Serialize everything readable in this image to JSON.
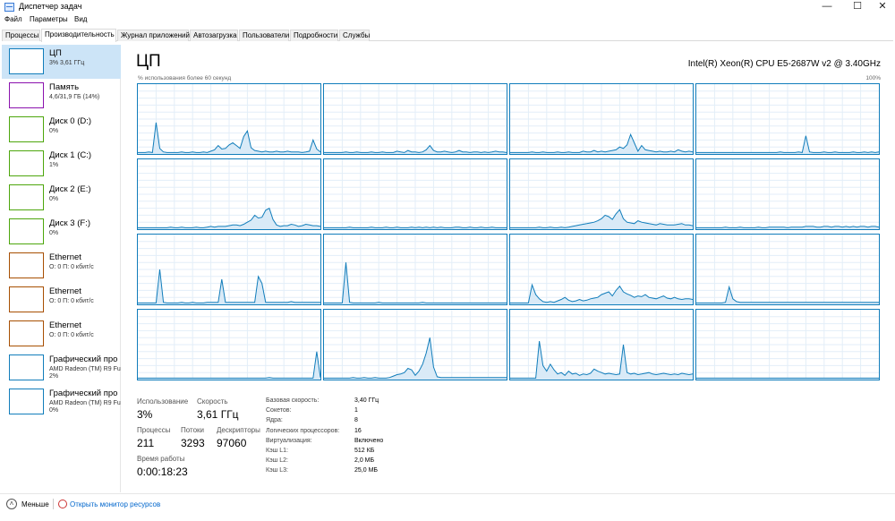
{
  "window": {
    "title": "Диспетчер задач",
    "min_glyph": "—",
    "max_glyph": "☐",
    "close_glyph": "✕"
  },
  "menu": [
    "Файл",
    "Параметры",
    "Вид"
  ],
  "tabs": [
    {
      "label": "Процессы",
      "active": false
    },
    {
      "label": "Производительность",
      "active": true
    },
    {
      "label": "Журнал приложений",
      "active": false
    },
    {
      "label": "Автозагрузка",
      "active": false
    },
    {
      "label": "Пользователи",
      "active": false
    },
    {
      "label": "Подробности",
      "active": false
    },
    {
      "label": "Службы",
      "active": false
    }
  ],
  "sidebar": [
    {
      "label": "ЦП",
      "sub": "3% 3,61 ГГц",
      "sub2": "",
      "color": "#117dbb",
      "icon": "cpu-graph-icon",
      "selected": true
    },
    {
      "label": "Память",
      "sub": "4,6/31,9 ГБ (14%)",
      "sub2": "",
      "color": "#8b12ae",
      "icon": "memory-graph-icon",
      "selected": false
    },
    {
      "label": "Диск 0 (D:)",
      "sub": "0%",
      "sub2": "",
      "color": "#4da60c",
      "icon": "disk-graph-icon",
      "selected": false
    },
    {
      "label": "Диск 1 (C:)",
      "sub": "1%",
      "sub2": "",
      "color": "#4da60c",
      "icon": "disk-graph-icon",
      "selected": false
    },
    {
      "label": "Диск 2 (E:)",
      "sub": "0%",
      "sub2": "",
      "color": "#4da60c",
      "icon": "disk-graph-icon",
      "selected": false
    },
    {
      "label": "Диск 3 (F:)",
      "sub": "0%",
      "sub2": "",
      "color": "#4da60c",
      "icon": "disk-graph-icon",
      "selected": false
    },
    {
      "label": "Ethernet",
      "sub": "О: 0 П: 0 кбит/с",
      "sub2": "",
      "color": "#a74f01",
      "icon": "network-graph-icon",
      "selected": false
    },
    {
      "label": "Ethernet",
      "sub": "О: 0 П: 0 кбит/с",
      "sub2": "",
      "color": "#a74f01",
      "icon": "network-graph-icon",
      "selected": false
    },
    {
      "label": "Ethernet",
      "sub": "О: 0 П: 0 кбит/с",
      "sub2": "",
      "color": "#a74f01",
      "icon": "network-graph-icon",
      "selected": false
    },
    {
      "label": "Графический про",
      "sub": "AMD Radeon (TM) R9 Fu",
      "sub2": "2%",
      "color": "#117dbb",
      "icon": "gpu-graph-icon",
      "selected": false
    },
    {
      "label": "Графический про",
      "sub": "AMD Radeon (TM) R9 Fu",
      "sub2": "0%",
      "color": "#117dbb",
      "icon": "gpu-graph-icon",
      "selected": false
    }
  ],
  "main": {
    "title": "ЦП",
    "cpu_model": "Intel(R) Xeon(R) CPU E5-2687W v2 @ 3.40GHz",
    "graph_caption_left": "% использования более 60 секунд",
    "graph_caption_right": "100%",
    "graph_color": "#117dbb",
    "graph_fill": "#d9eaf7"
  },
  "chart_data": {
    "type": "area",
    "title": "",
    "ylim": [
      0,
      100
    ],
    "grid": true,
    "series": [
      {
        "values": [
          2,
          2,
          2,
          3,
          2,
          45,
          8,
          3,
          2,
          2,
          2,
          2,
          3,
          2,
          2,
          3,
          2,
          2,
          3,
          2,
          4,
          6,
          12,
          7,
          8,
          13,
          16,
          12,
          8,
          25,
          33,
          9,
          5,
          4,
          3,
          4,
          3,
          3,
          4,
          3,
          3,
          4,
          3,
          3,
          3,
          2,
          3,
          4,
          20,
          7,
          3
        ]
      },
      {
        "values": [
          2,
          2,
          2,
          2,
          2,
          2,
          3,
          2,
          2,
          3,
          2,
          2,
          2,
          3,
          2,
          2,
          3,
          2,
          2,
          2,
          4,
          3,
          2,
          5,
          3,
          3,
          2,
          3,
          6,
          12,
          5,
          3,
          3,
          4,
          3,
          2,
          3,
          5,
          3,
          3,
          2,
          3,
          3,
          2,
          3,
          2,
          3,
          4,
          3,
          3,
          2
        ]
      },
      {
        "values": [
          2,
          2,
          2,
          2,
          2,
          2,
          3,
          2,
          2,
          3,
          2,
          2,
          2,
          3,
          2,
          2,
          3,
          2,
          2,
          2,
          4,
          3,
          3,
          5,
          3,
          4,
          3,
          4,
          5,
          6,
          10,
          8,
          13,
          28,
          16,
          4,
          12,
          6,
          5,
          4,
          3,
          4,
          3,
          3,
          4,
          3,
          6,
          4,
          3,
          4,
          3
        ]
      },
      {
        "values": [
          2,
          2,
          2,
          2,
          2,
          2,
          2,
          2,
          2,
          2,
          2,
          2,
          2,
          2,
          2,
          2,
          2,
          2,
          2,
          2,
          2,
          2,
          2,
          3,
          2,
          2,
          2,
          2,
          3,
          2,
          26,
          3,
          2,
          2,
          2,
          3,
          2,
          2,
          3,
          2,
          2,
          2,
          2,
          3,
          2,
          2,
          3,
          2,
          3,
          2,
          3
        ]
      },
      {
        "values": [
          2,
          2,
          2,
          2,
          2,
          2,
          2,
          2,
          2,
          3,
          2,
          2,
          3,
          2,
          2,
          2,
          3,
          2,
          2,
          3,
          4,
          3,
          4,
          4,
          4,
          5,
          6,
          6,
          5,
          7,
          10,
          13,
          20,
          16,
          17,
          27,
          30,
          14,
          6,
          4,
          5,
          5,
          7,
          6,
          4,
          5,
          7,
          6,
          5,
          5,
          4
        ]
      },
      {
        "values": [
          2,
          2,
          2,
          2,
          2,
          2,
          2,
          3,
          2,
          2,
          2,
          2,
          2,
          3,
          2,
          2,
          2,
          3,
          2,
          2,
          3,
          2,
          2,
          2,
          3,
          2,
          3,
          2,
          3,
          2,
          3,
          2,
          3,
          2,
          2,
          2,
          3,
          3,
          2,
          2,
          3,
          2,
          2,
          3,
          2,
          2,
          3,
          2,
          2,
          2,
          2
        ]
      },
      {
        "values": [
          2,
          2,
          2,
          2,
          2,
          2,
          2,
          2,
          3,
          2,
          2,
          3,
          2,
          2,
          3,
          2,
          3,
          4,
          5,
          6,
          7,
          8,
          9,
          10,
          12,
          15,
          20,
          18,
          14,
          22,
          28,
          15,
          10,
          9,
          8,
          12,
          10,
          9,
          8,
          7,
          6,
          8,
          7,
          6,
          6,
          6,
          7,
          8,
          6,
          6,
          5
        ]
      },
      {
        "values": [
          2,
          2,
          2,
          2,
          2,
          2,
          2,
          2,
          3,
          2,
          2,
          2,
          3,
          2,
          2,
          2,
          2,
          3,
          2,
          2,
          3,
          3,
          3,
          3,
          3,
          2,
          3,
          3,
          3,
          3,
          4,
          4,
          4,
          3,
          3,
          4,
          4,
          3,
          4,
          4,
          3,
          4,
          3,
          4,
          3,
          4,
          4,
          3,
          4,
          4,
          3
        ]
      },
      {
        "values": [
          2,
          2,
          2,
          2,
          2,
          2,
          50,
          3,
          2,
          2,
          2,
          2,
          3,
          2,
          2,
          3,
          2,
          2,
          2,
          3,
          3,
          3,
          3,
          36,
          3,
          3,
          3,
          3,
          3,
          3,
          3,
          3,
          3,
          40,
          30,
          3,
          3,
          3,
          3,
          3,
          3,
          3,
          4,
          3,
          3,
          3,
          3,
          3,
          3,
          3,
          3
        ]
      },
      {
        "values": [
          2,
          2,
          2,
          2,
          2,
          2,
          60,
          3,
          2,
          2,
          2,
          2,
          2,
          2,
          2,
          3,
          2,
          2,
          2,
          2,
          2,
          2,
          2,
          2,
          2,
          2,
          2,
          3,
          2,
          2,
          2,
          2,
          2,
          2,
          2,
          2,
          2,
          2,
          2,
          2,
          2,
          2,
          2,
          2,
          2,
          2,
          2,
          2,
          2,
          2,
          2
        ]
      },
      {
        "values": [
          2,
          2,
          2,
          2,
          2,
          2,
          28,
          14,
          8,
          4,
          3,
          4,
          3,
          5,
          7,
          10,
          6,
          4,
          5,
          7,
          5,
          6,
          8,
          9,
          10,
          14,
          16,
          18,
          12,
          20,
          26,
          18,
          15,
          13,
          10,
          12,
          11,
          14,
          10,
          9,
          8,
          10,
          12,
          9,
          8,
          10,
          8,
          7,
          8,
          8,
          7
        ]
      },
      {
        "values": [
          2,
          2,
          2,
          2,
          2,
          2,
          2,
          2,
          3,
          25,
          8,
          4,
          3,
          3,
          3,
          3,
          3,
          3,
          3,
          3,
          3,
          3,
          3,
          3,
          3,
          3,
          3,
          3,
          3,
          3,
          3,
          3,
          3,
          3,
          3,
          3,
          3,
          3,
          3,
          3,
          3,
          3,
          3,
          3,
          3,
          3,
          3,
          3,
          3,
          3,
          3
        ]
      },
      {
        "values": [
          2,
          2,
          2,
          2,
          2,
          2,
          2,
          2,
          2,
          2,
          2,
          2,
          2,
          2,
          2,
          2,
          2,
          2,
          2,
          2,
          2,
          2,
          2,
          2,
          2,
          2,
          2,
          2,
          2,
          2,
          2,
          2,
          2,
          2,
          2,
          2,
          3,
          2,
          2,
          2,
          2,
          2,
          2,
          2,
          2,
          2,
          2,
          2,
          2,
          40,
          3
        ]
      },
      {
        "values": [
          2,
          2,
          2,
          2,
          2,
          2,
          2,
          2,
          3,
          2,
          2,
          3,
          2,
          2,
          3,
          2,
          2,
          2,
          3,
          5,
          7,
          8,
          10,
          16,
          14,
          6,
          12,
          22,
          38,
          60,
          18,
          4,
          3,
          3,
          3,
          3,
          3,
          3,
          3,
          3,
          3,
          3,
          3,
          3,
          3,
          3,
          3,
          3,
          3,
          3,
          3
        ]
      },
      {
        "values": [
          2,
          2,
          2,
          2,
          2,
          2,
          2,
          2,
          55,
          20,
          12,
          22,
          14,
          8,
          10,
          6,
          12,
          8,
          9,
          6,
          8,
          7,
          9,
          15,
          12,
          10,
          8,
          9,
          8,
          7,
          8,
          50,
          10,
          8,
          9,
          7,
          8,
          9,
          10,
          8,
          7,
          8,
          9,
          8,
          7,
          8,
          7,
          9,
          8,
          7,
          8
        ]
      },
      {
        "values": [
          2,
          2,
          2,
          2,
          2,
          2,
          2,
          2,
          2,
          2,
          2,
          2,
          2,
          2,
          2,
          2,
          2,
          2,
          2,
          2,
          2,
          2,
          2,
          2,
          2,
          2,
          2,
          2,
          2,
          2,
          2,
          2,
          2,
          2,
          2,
          2,
          2,
          2,
          2,
          2,
          2,
          2,
          2,
          2,
          2,
          2,
          2,
          2,
          2,
          2,
          2
        ]
      }
    ]
  },
  "stats": {
    "usage_label": "Использование",
    "usage_value": "3%",
    "speed_label": "Скорость",
    "speed_value": "3,61 ГГц",
    "processes_label": "Процессы",
    "processes_value": "211",
    "threads_label": "Потоки",
    "threads_value": "3293",
    "handles_label": "Дескрипторы",
    "handles_value": "97060",
    "uptime_label": "Время работы",
    "uptime_value": "0:00:18:23"
  },
  "details": [
    {
      "key": "Базовая скорость:",
      "value": "3,40 ГГц"
    },
    {
      "key": "Сокетов:",
      "value": "1"
    },
    {
      "key": "Ядра:",
      "value": "8"
    },
    {
      "key": "Логических процессоров:",
      "value": "16"
    },
    {
      "key": "Виртуализация:",
      "value": "Включено"
    },
    {
      "key": "Кэш L1:",
      "value": "512 КБ"
    },
    {
      "key": "Кэш L2:",
      "value": "2,0 МБ"
    },
    {
      "key": "Кэш L3:",
      "value": "25,0 МБ"
    }
  ],
  "footer": {
    "less_label": "Меньше",
    "less_icon": "chevron-up-icon",
    "monitor_label": "Открыть монитор ресурсов",
    "monitor_icon": "resource-monitor-icon"
  }
}
